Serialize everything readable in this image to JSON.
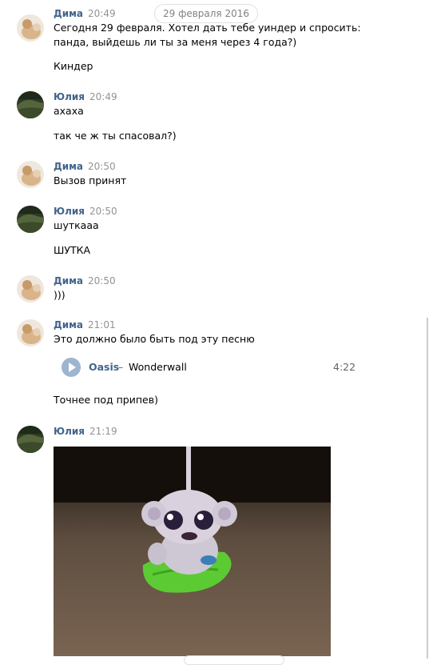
{
  "date_pill": "29 февраля 2016",
  "messages": [
    {
      "author": "Дима",
      "time": "20:49",
      "lines": [
        "Сегодня 29 февраля. Хотел дать тебе уиндер и спросить:",
        "панда, выйдешь ли ты за меня через 4 года?)",
        "Киндер"
      ]
    },
    {
      "author": "Юлия",
      "time": "20:49",
      "lines": [
        "ахаха",
        "так че ж ты спасовал?)"
      ]
    },
    {
      "author": "Дима",
      "time": "20:50",
      "lines": [
        "Вызов принят"
      ]
    },
    {
      "author": "Юлия",
      "time": "20:50",
      "lines": [
        "шуткааа",
        "ШУТКА"
      ]
    },
    {
      "author": "Дима",
      "time": "20:50",
      "lines": [
        ")))"
      ]
    },
    {
      "author": "Дима",
      "time": "21:01",
      "lines": [
        "Это должно было быть под эту песню",
        "Точнее под припев)"
      ],
      "audio": {
        "artist": "Oasis",
        "separator": "–",
        "title": "Wonderwall",
        "duration": "4:22"
      }
    },
    {
      "author": "Юлия",
      "time": "21:19",
      "lines": [],
      "has_photo": true
    }
  ],
  "colors": {
    "author": "#42648b",
    "time": "#939393",
    "play": "#9eb4cf"
  },
  "icons": {
    "play": "play-icon",
    "avatar_dima": "avatar-dima",
    "avatar_yulia": "avatar-yulia"
  }
}
